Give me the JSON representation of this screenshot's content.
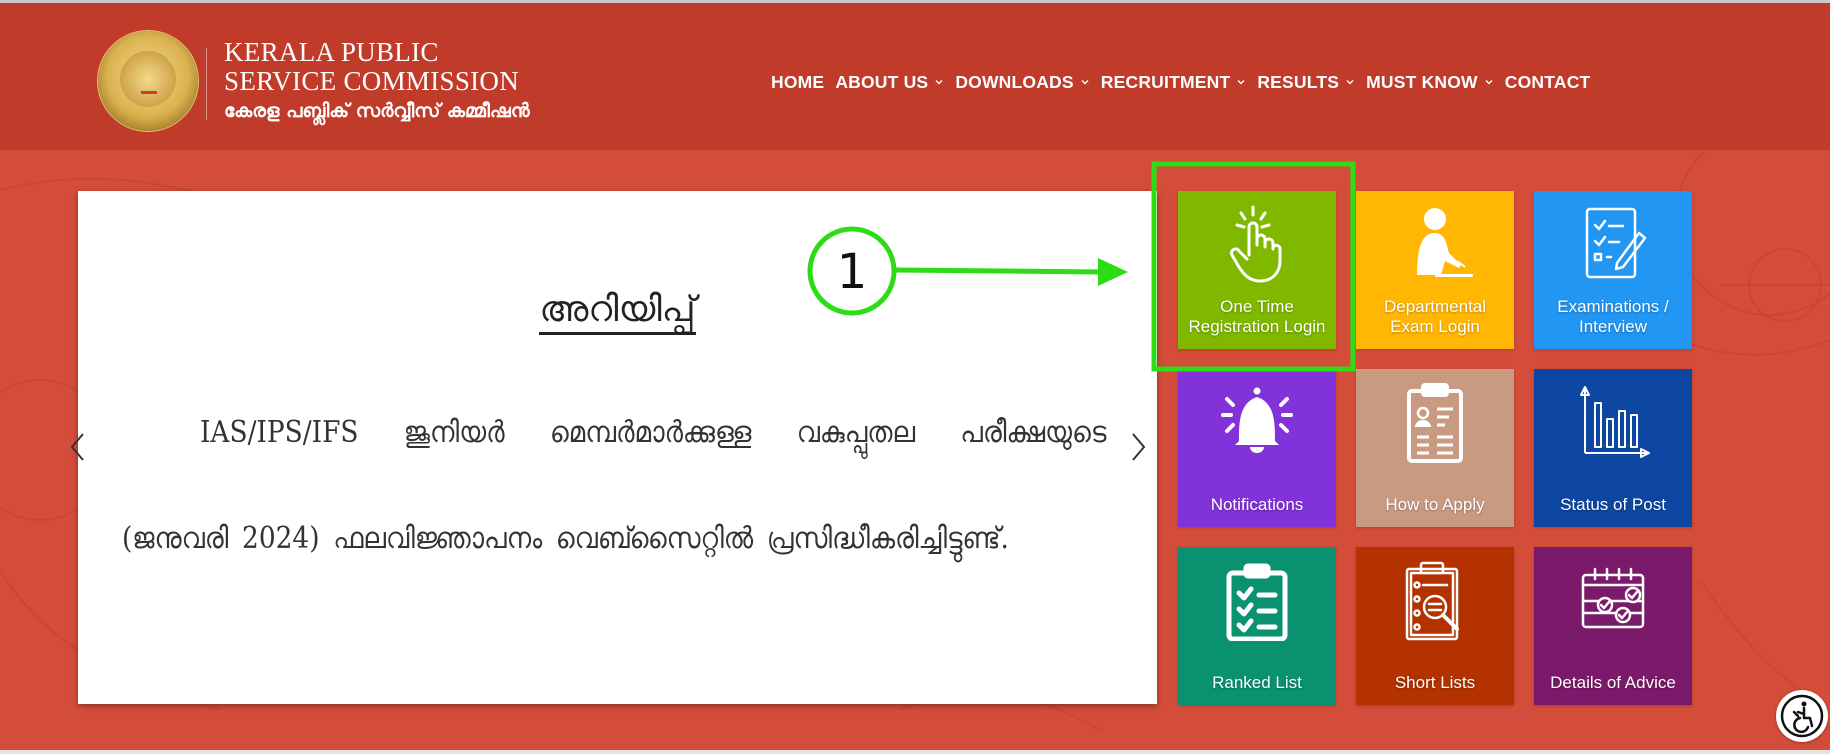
{
  "header": {
    "title_line1": "KERALA PUBLIC",
    "title_line2": "SERVICE COMMISSION",
    "title_malayalam": "കേരള പബ്ലിക് സർവ്വീസ് കമ്മീഷൻ",
    "logo_icon": "kpsc-emblem-icon"
  },
  "nav": {
    "items": [
      {
        "label": "HOME",
        "dropdown": false
      },
      {
        "label": "ABOUT US",
        "dropdown": true
      },
      {
        "label": "DOWNLOADS",
        "dropdown": true
      },
      {
        "label": "RECRUITMENT",
        "dropdown": true
      },
      {
        "label": "RESULTS",
        "dropdown": true
      },
      {
        "label": "MUST KNOW",
        "dropdown": true
      },
      {
        "label": "CONTACT",
        "dropdown": false
      }
    ]
  },
  "slider": {
    "title": "അറിയിപ്പ്",
    "line1_words": [
      "IAS/IPS/IFS",
      "ജൂനിയർ",
      "മെമ്പർമാർക്കുള്ള",
      "വകുപ്പുതല",
      "പരീക്ഷയുടെ"
    ],
    "line2": "(ജനുവരി 2024)  ഫലവിജ്ഞാപനം വെബ്സൈറ്റിൽ പ്രസിദ്ധീകരിച്ചിട്ടുണ്ട്.",
    "prev_icon": "chevron-left-icon",
    "next_icon": "chevron-right-icon"
  },
  "tiles": [
    {
      "label": "One Time Registration Login",
      "icon": "hand-tap-icon",
      "color": "#80b800"
    },
    {
      "label": "Departmental Exam Login",
      "icon": "person-writing-icon",
      "color": "#ffb703"
    },
    {
      "label": "Examinations / Interview",
      "icon": "checklist-pencil-icon",
      "color": "#2196f3"
    },
    {
      "label": "Notifications",
      "icon": "bell-icon",
      "color": "#8232d9"
    },
    {
      "label": "How to Apply",
      "icon": "clipboard-profile-icon",
      "color": "#c99a82"
    },
    {
      "label": "Status of Post",
      "icon": "bar-chart-icon",
      "color": "#0d47a1"
    },
    {
      "label": "Ranked List",
      "icon": "clipboard-checklist-icon",
      "color": "#0a9270"
    },
    {
      "label": "Short Lists",
      "icon": "clipboard-search-icon",
      "color": "#b33200"
    },
    {
      "label": "Details of Advice",
      "icon": "calendar-check-icon",
      "color": "#7b1a6b"
    }
  ],
  "annotation": {
    "step_number": "1",
    "color": "#2ddc15"
  },
  "accessibility": {
    "icon": "accessibility-icon"
  },
  "colors": {
    "header_bg": "#c13b2b",
    "page_bg": "#d44d3a"
  }
}
